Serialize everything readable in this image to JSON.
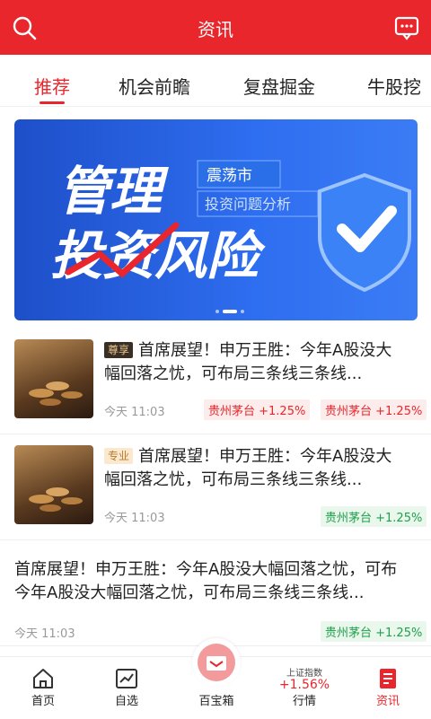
{
  "header": {
    "title": "资讯"
  },
  "tabs": [
    {
      "label": "推荐"
    },
    {
      "label": "机会前瞻"
    },
    {
      "label": "复盘掘金"
    },
    {
      "label": "牛股挖"
    }
  ],
  "banner": {
    "big1": "管理",
    "big2": "投资风险",
    "tag1": "震荡市",
    "tag2": "投资问题分析"
  },
  "news": [
    {
      "badge": "尊享",
      "title_line1": "首席展望！申万王胜：今年A股没大",
      "title_line2": "幅回落之忧，可布局三条线三条线...",
      "time": "今天 11:03",
      "stocks": [
        "贵州茅台 +1.25%",
        "贵州茅台 +1.25%"
      ]
    },
    {
      "badge": "专业",
      "title_line1": "首席展望！申万王胜：今年A股没大",
      "title_line2": "幅回落之忧，可布局三条线三条线...",
      "time": "今天 11:03",
      "stocks": [
        "贵州茅台 +1.25%"
      ]
    },
    {
      "title_line1": "首席展望！申万王胜：今年A股没大幅回落之忧，可布",
      "title_line2": "今年A股没大幅回落之忧，可布局三条线三条线...",
      "time": "今天 11:03",
      "stocks": [
        "贵州茅台 +1.25%"
      ]
    }
  ],
  "tabbar": {
    "home": "首页",
    "watchlist": "自选",
    "toolbox": "百宝箱",
    "index_name": "上证指数",
    "index_value": "+1.56%",
    "market": "行情",
    "news": "资讯"
  }
}
